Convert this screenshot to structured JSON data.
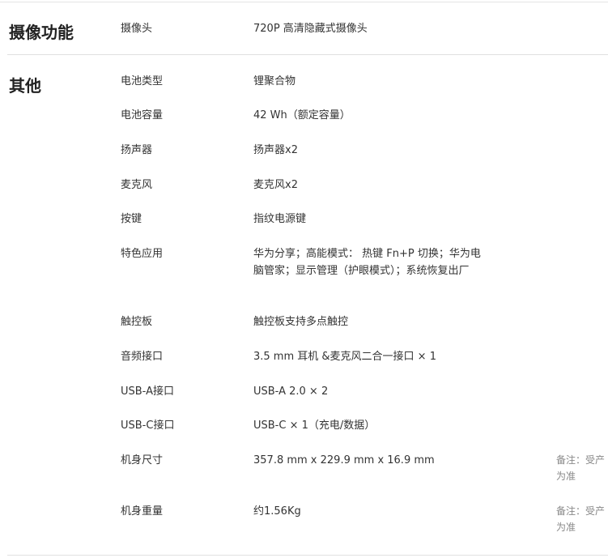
{
  "sections": [
    {
      "title": "摄像功能",
      "rows": [
        {
          "label": "摄像头",
          "value": "720P 高清隐藏式摄像头",
          "note": ""
        }
      ]
    },
    {
      "title": "其他",
      "rows": [
        {
          "label": "电池类型",
          "value": "锂聚合物",
          "note": ""
        },
        {
          "label": "电池容量",
          "value": "42 Wh（额定容量）",
          "note": ""
        },
        {
          "label": "扬声器",
          "value": "扬声器x2",
          "note": ""
        },
        {
          "label": "麦克风",
          "value": "麦克风x2",
          "note": ""
        },
        {
          "label": "按键",
          "value": "指纹电源键",
          "note": ""
        },
        {
          "label": "特色应用",
          "value": "华为分享；高能模式： 热键 Fn+P 切换；华为电脑管家；显示管理（护眼模式）；系统恢复出厂",
          "note": ""
        },
        {
          "label": "触控板",
          "value": "触控板支持多点触控",
          "note": ""
        },
        {
          "label": "音频接口",
          "value": "3.5 mm 耳机 &麦克风二合一接口 × 1",
          "note": ""
        },
        {
          "label": "USB-A接口",
          "value": "USB-A 2.0 × 2",
          "note": ""
        },
        {
          "label": "USB-C接口",
          "value": "USB-C × 1（充电/数据）",
          "note": ""
        },
        {
          "label": "机身尺寸",
          "value": "357.8 mm x 229.9 mm x 16.9 mm",
          "note": "备注：受产为准"
        },
        {
          "label": "机身重量",
          "value": "约1.56Kg",
          "note": "备注：受产为准"
        }
      ]
    }
  ]
}
